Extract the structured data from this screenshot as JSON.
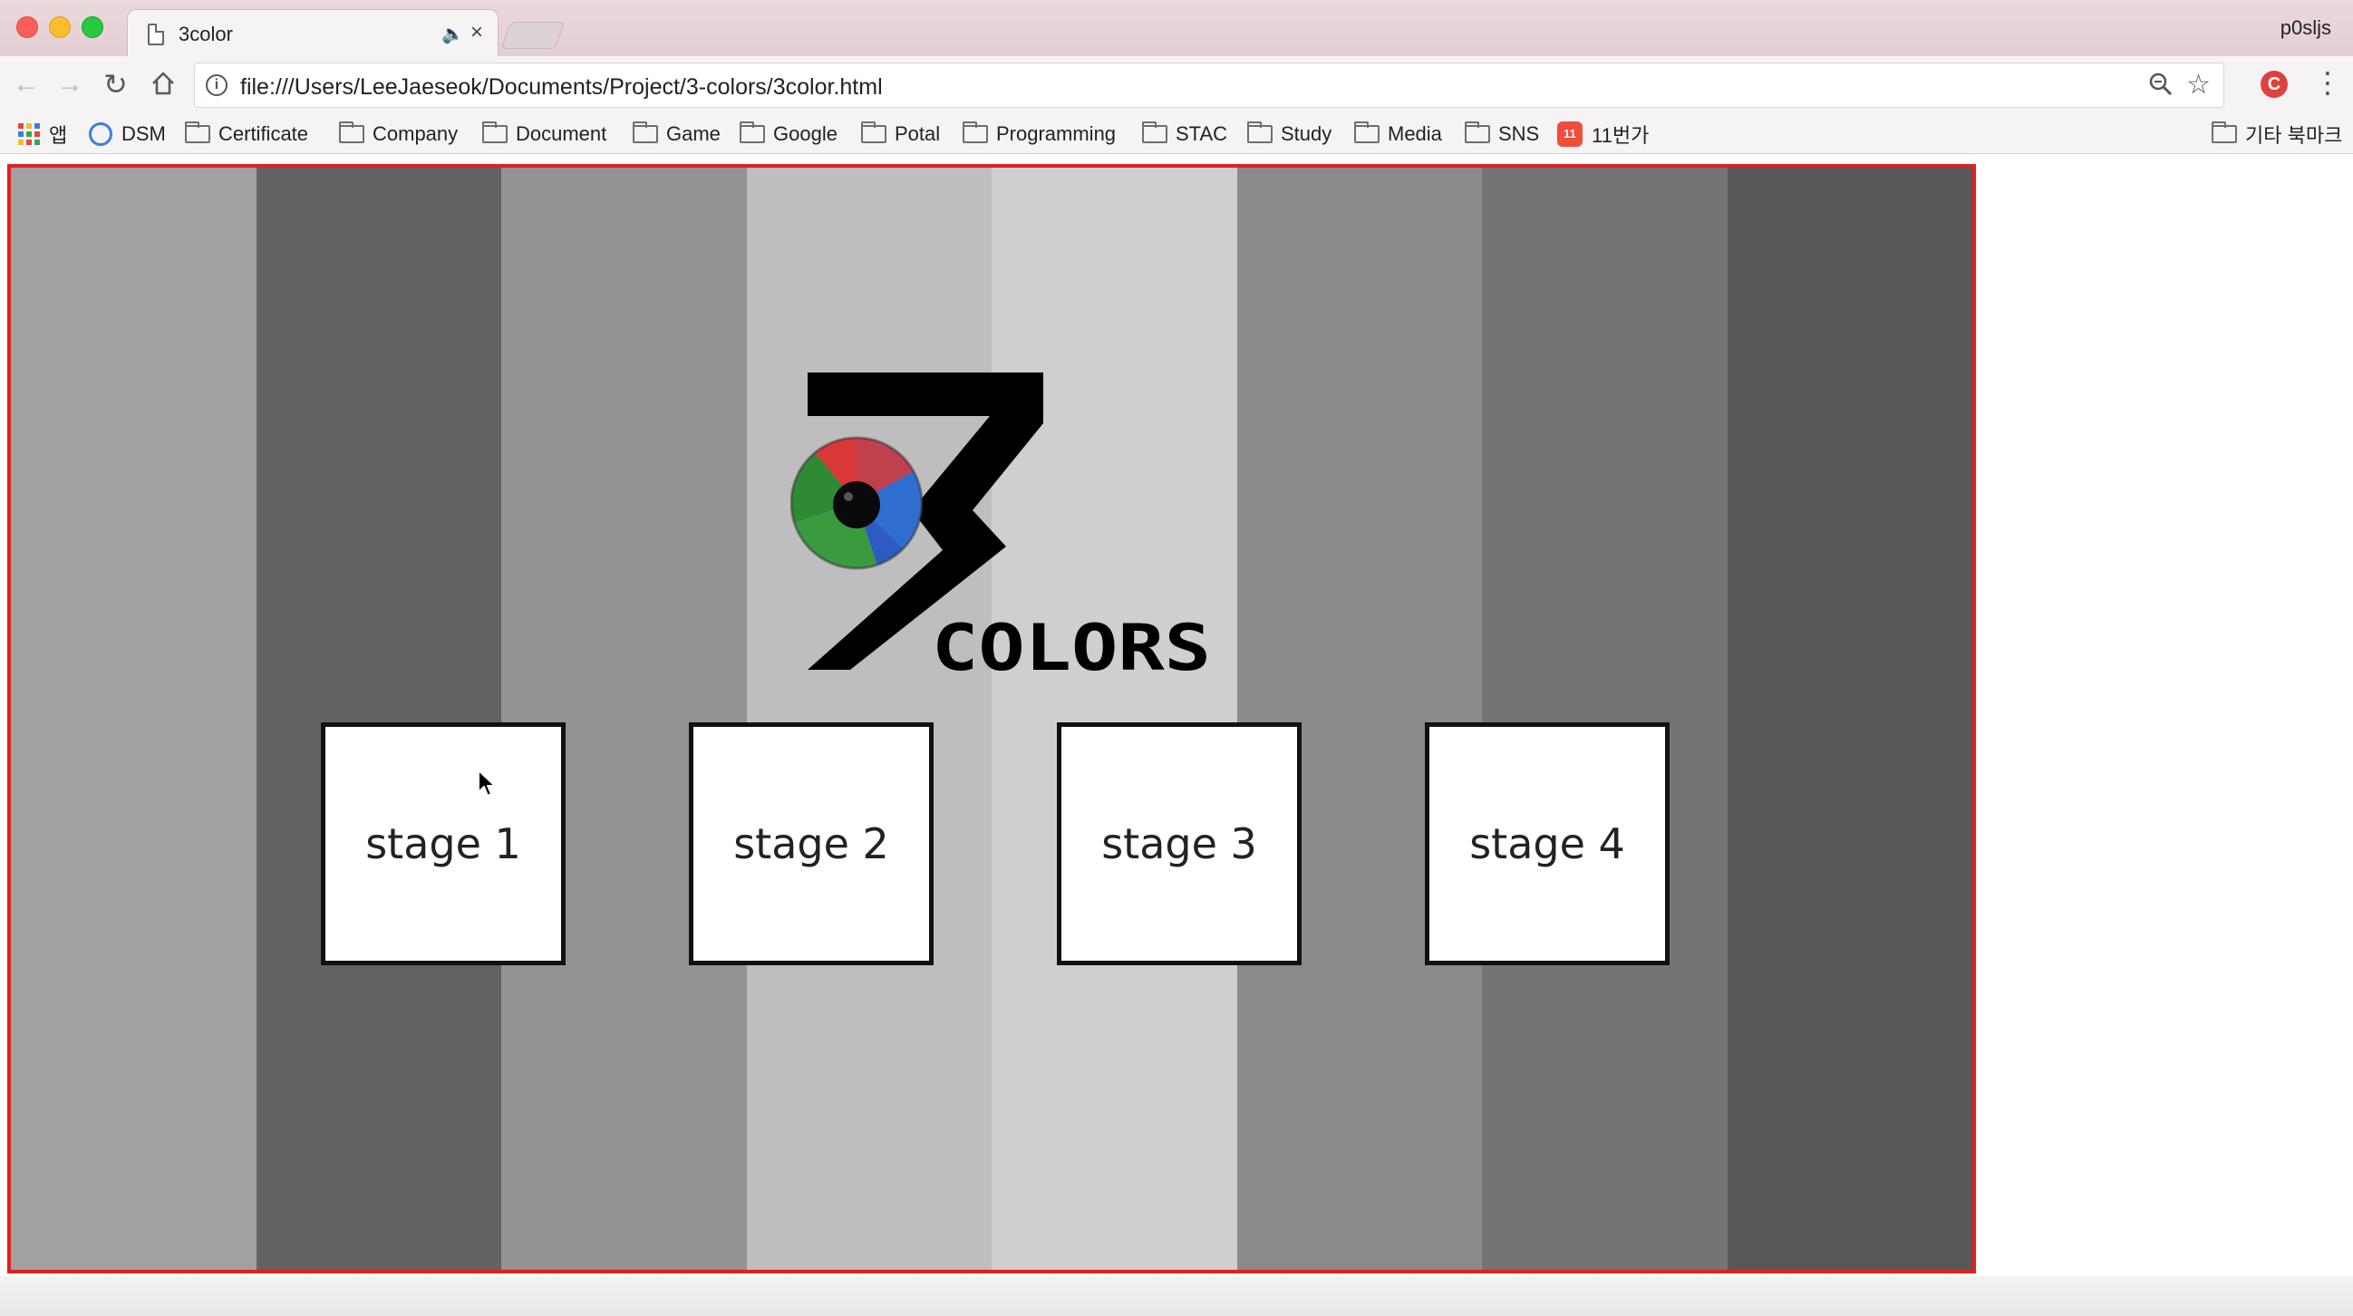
{
  "window": {
    "tab_title": "3color",
    "profile_name": "p0sljs"
  },
  "address_bar": {
    "url": "file:///Users/LeeJaeseok/Documents/Project/3-colors/3color.html"
  },
  "bookmarks": {
    "apps_label": "앱",
    "items": [
      {
        "label": "DSM",
        "icon": "dsm-icon"
      },
      {
        "label": "Certificate",
        "icon": "folder-icon"
      },
      {
        "label": "Company",
        "icon": "folder-icon"
      },
      {
        "label": "Document",
        "icon": "folder-icon"
      },
      {
        "label": "Game",
        "icon": "folder-icon"
      },
      {
        "label": "Google",
        "icon": "folder-icon"
      },
      {
        "label": "Potal",
        "icon": "folder-icon"
      },
      {
        "label": "Programming",
        "icon": "folder-icon"
      },
      {
        "label": "STAC",
        "icon": "folder-icon"
      },
      {
        "label": "Study",
        "icon": "folder-icon"
      },
      {
        "label": "Media",
        "icon": "folder-icon"
      },
      {
        "label": "SNS",
        "icon": "folder-icon"
      },
      {
        "label": "11번가",
        "icon": "elevenst-icon"
      }
    ],
    "other_bookmarks": "기타 북마크"
  },
  "game": {
    "logo_text": "COLORS",
    "stripe_colors": [
      "#a1a1a1",
      "#636363",
      "#939393",
      "#bebebe",
      "#cfcfcf",
      "#8a8a8a",
      "#747474",
      "#575757"
    ],
    "border_color": "#e02020",
    "stages": [
      {
        "label": "stage 1"
      },
      {
        "label": "stage 2"
      },
      {
        "label": "stage 3"
      },
      {
        "label": "stage 4"
      }
    ]
  }
}
